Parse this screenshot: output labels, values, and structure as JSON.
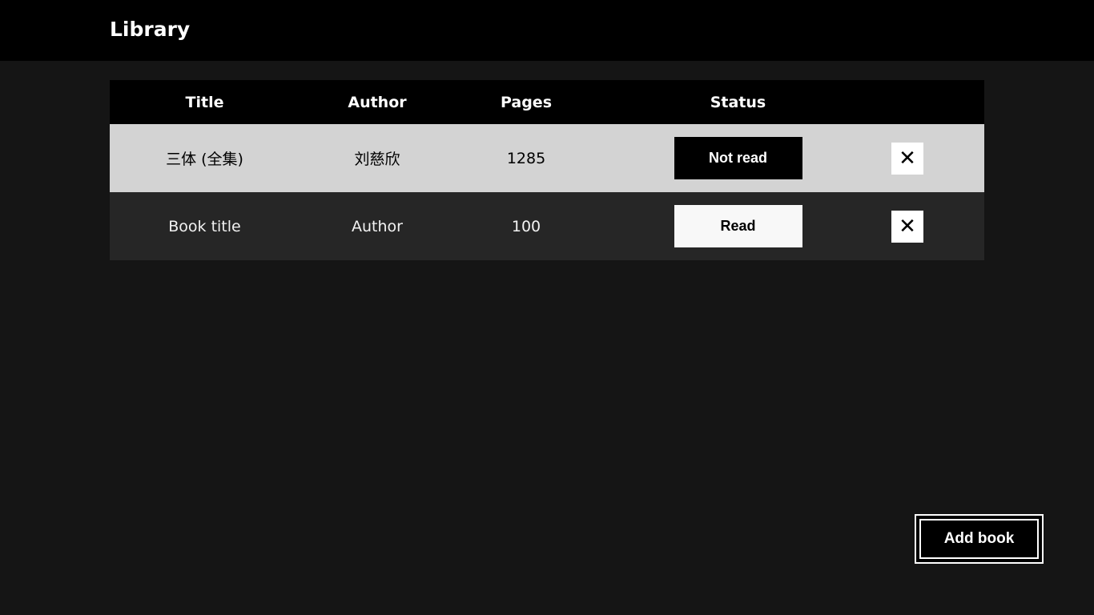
{
  "header": {
    "title": "Library"
  },
  "table": {
    "columns": [
      "Title",
      "Author",
      "Pages",
      "Status"
    ],
    "rows": [
      {
        "title": "三体 (全集)",
        "author": "刘慈欣",
        "pages": "1285",
        "status": "Not read",
        "delete": "✕"
      },
      {
        "title": "Book title",
        "author": "Author",
        "pages": "100",
        "status": "Read",
        "delete": "✕"
      }
    ]
  },
  "actions": {
    "add_book": "Add book"
  }
}
